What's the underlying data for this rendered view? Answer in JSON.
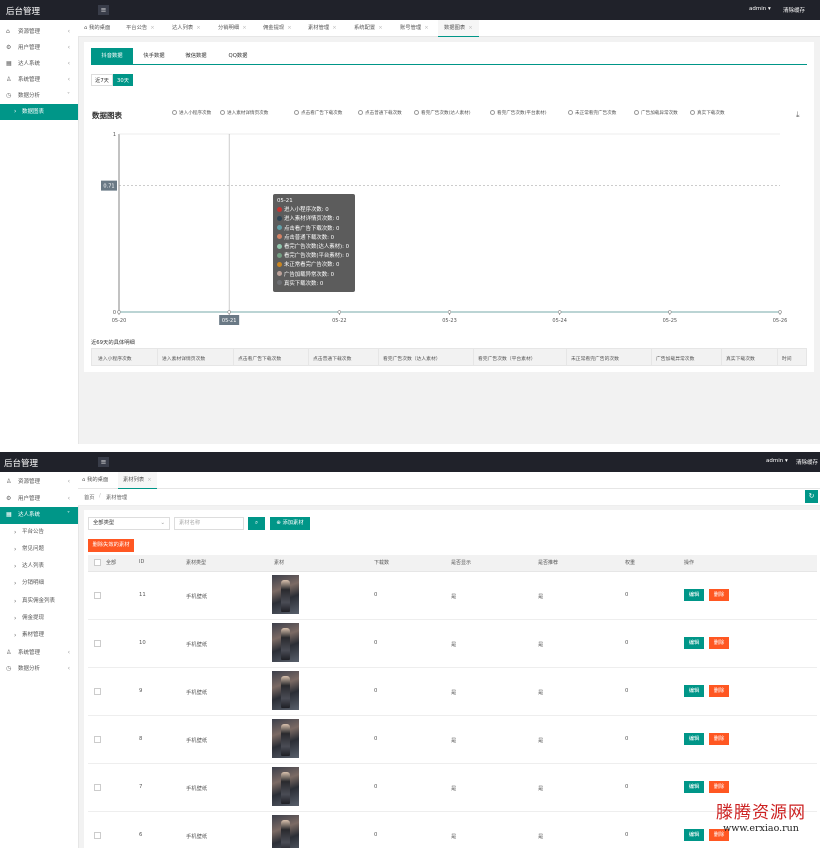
{
  "app": {
    "title": "后台管理",
    "menu_icon": "hamburger-icon"
  },
  "panel_a": {
    "header": {
      "user": "admin",
      "clear_cache": "清除缓存"
    },
    "sidebar": [
      {
        "icon": "home-icon",
        "label": "资源管理"
      },
      {
        "icon": "gear-icon",
        "label": "用户管理"
      },
      {
        "icon": "apps-icon",
        "label": "达人系统"
      },
      {
        "icon": "user-icon",
        "label": "系统管理"
      },
      {
        "icon": "chart-icon",
        "label": "数据分析"
      },
      {
        "icon": "chevron-right-icon",
        "label": "数据图表"
      }
    ],
    "tabs": [
      "我的桌面",
      "平台公告",
      "达人列表",
      "分销明细",
      "佣金提现",
      "素材管理",
      "系统配置",
      "账号管理",
      "数据图表"
    ],
    "sub_tabs": [
      "抖音数据",
      "快手数据",
      "微信数据",
      "QQ数据"
    ],
    "day_buttons": [
      "近7天",
      "30天"
    ],
    "table_title": "近69天的具体明细",
    "table_headers": [
      "进入小程序次数",
      "进入素材详情页次数",
      "点击看广告下载次数",
      "点击普通下载次数",
      "看完广告次数（达人素材）",
      "看完广告次数（平台素材）",
      "未正常看完广告的次数",
      "广告加载异常次数",
      "真实下载次数",
      "时间"
    ]
  },
  "chart_data": {
    "type": "line",
    "title": "数据图表",
    "categories": [
      "05-20",
      "05-21",
      "05-22",
      "05-23",
      "05-24",
      "05-25",
      "05-26"
    ],
    "series": [
      {
        "name": "进入小程序次数",
        "values": [
          0,
          0,
          0,
          0,
          0,
          0,
          0
        ]
      },
      {
        "name": "进入素材详情页次数",
        "values": [
          0,
          0,
          0,
          0,
          0,
          0,
          0
        ]
      },
      {
        "name": "点击看广告下载次数",
        "values": [
          0,
          0,
          0,
          0,
          0,
          0,
          0
        ]
      },
      {
        "name": "点击普通下载次数",
        "values": [
          0,
          0,
          0,
          0,
          0,
          0,
          0
        ]
      },
      {
        "name": "看完广告次数(达人素材)",
        "values": [
          0,
          0,
          0,
          0,
          0,
          0,
          0
        ]
      },
      {
        "name": "看完广告次数(平台素材)",
        "values": [
          0,
          0,
          0,
          0,
          0,
          0,
          0
        ]
      },
      {
        "name": "未正常看完广告次数",
        "values": [
          0,
          0,
          0,
          0,
          0,
          0,
          0
        ]
      },
      {
        "name": "广告加载异常次数",
        "values": [
          0,
          0,
          0,
          0,
          0,
          0,
          0
        ]
      },
      {
        "name": "真实下载次数",
        "values": [
          0,
          0,
          0,
          0,
          0,
          0,
          0
        ]
      }
    ],
    "ylim": [
      0,
      1
    ],
    "y_ticks": [
      "0",
      "1"
    ],
    "y_pointer": "0.71",
    "x_pointer": "05-21",
    "legend_position": "top",
    "tooltip": {
      "title": "05-21",
      "rows": [
        {
          "text": "进入小程序次数: 0",
          "color": "#c23531"
        },
        {
          "text": "进入素材详情页次数: 0",
          "color": "#2f4554"
        },
        {
          "text": "点击看广告下载次数: 0",
          "color": "#61a0a8"
        },
        {
          "text": "点击普通下载次数: 0",
          "color": "#d48265"
        },
        {
          "text": "看完广告次数(达人素材): 0",
          "color": "#91c7ae"
        },
        {
          "text": "看完广告次数(平台素材): 0",
          "color": "#749f83"
        },
        {
          "text": "未正常看完广告次数: 0",
          "color": "#ca8622"
        },
        {
          "text": "广告加载异常次数: 0",
          "color": "#bda29a"
        },
        {
          "text": "真实下载次数: 0",
          "color": "#6e7074"
        }
      ]
    }
  },
  "panel_b": {
    "header": {
      "user": "admin",
      "clear_cache": "清除缓存"
    },
    "sidebar_top": [
      {
        "icon": "user-icon",
        "label": "资源管理"
      },
      {
        "icon": "gear-icon",
        "label": "用户管理"
      },
      {
        "icon": "apps-icon",
        "label": "达人系统"
      }
    ],
    "sidebar_sub": [
      "平台公告",
      "常见问题",
      "达人列表",
      "分销明细",
      "真实佣金列表",
      "佣金提现",
      "素材管理"
    ],
    "sidebar_bottom": [
      {
        "icon": "user-icon",
        "label": "系统管理"
      },
      {
        "icon": "chart-icon",
        "label": "数据分析"
      }
    ],
    "tabs": [
      "我的桌面",
      "素材列表"
    ],
    "breadcrumb": {
      "home": "首页",
      "separator": "/",
      "current": "素材管理"
    },
    "filter": {
      "type_select": "全部类型",
      "name_placeholder": "素材名称",
      "add_button": "添加素材"
    },
    "delete_invalid": "删除失效的素材",
    "columns": [
      "全部",
      "ID",
      "素材类型",
      "素材",
      "下载数",
      "是否显示",
      "是否推荐",
      "权重",
      "操作"
    ],
    "rows": [
      {
        "id": "11",
        "type": "手机壁纸",
        "downloads": "0",
        "show": "是",
        "recommend": "是",
        "weight": "0"
      },
      {
        "id": "10",
        "type": "手机壁纸",
        "downloads": "0",
        "show": "是",
        "recommend": "是",
        "weight": "0"
      },
      {
        "id": "9",
        "type": "手机壁纸",
        "downloads": "0",
        "show": "是",
        "recommend": "是",
        "weight": "0"
      },
      {
        "id": "8",
        "type": "手机壁纸",
        "downloads": "0",
        "show": "是",
        "recommend": "是",
        "weight": "0"
      },
      {
        "id": "7",
        "type": "手机壁纸",
        "downloads": "0",
        "show": "是",
        "recommend": "是",
        "weight": "0"
      },
      {
        "id": "6",
        "type": "手机壁纸",
        "downloads": "0",
        "show": "是",
        "recommend": "是",
        "weight": "0"
      }
    ],
    "edit_label": "编辑",
    "delete_label": "删除"
  },
  "watermark": {
    "name": "滕腾资源网",
    "url": "www.erxiao.run"
  },
  "colors": {
    "accent": "#009688",
    "danger": "#ff5722",
    "topbar": "#20222a"
  }
}
